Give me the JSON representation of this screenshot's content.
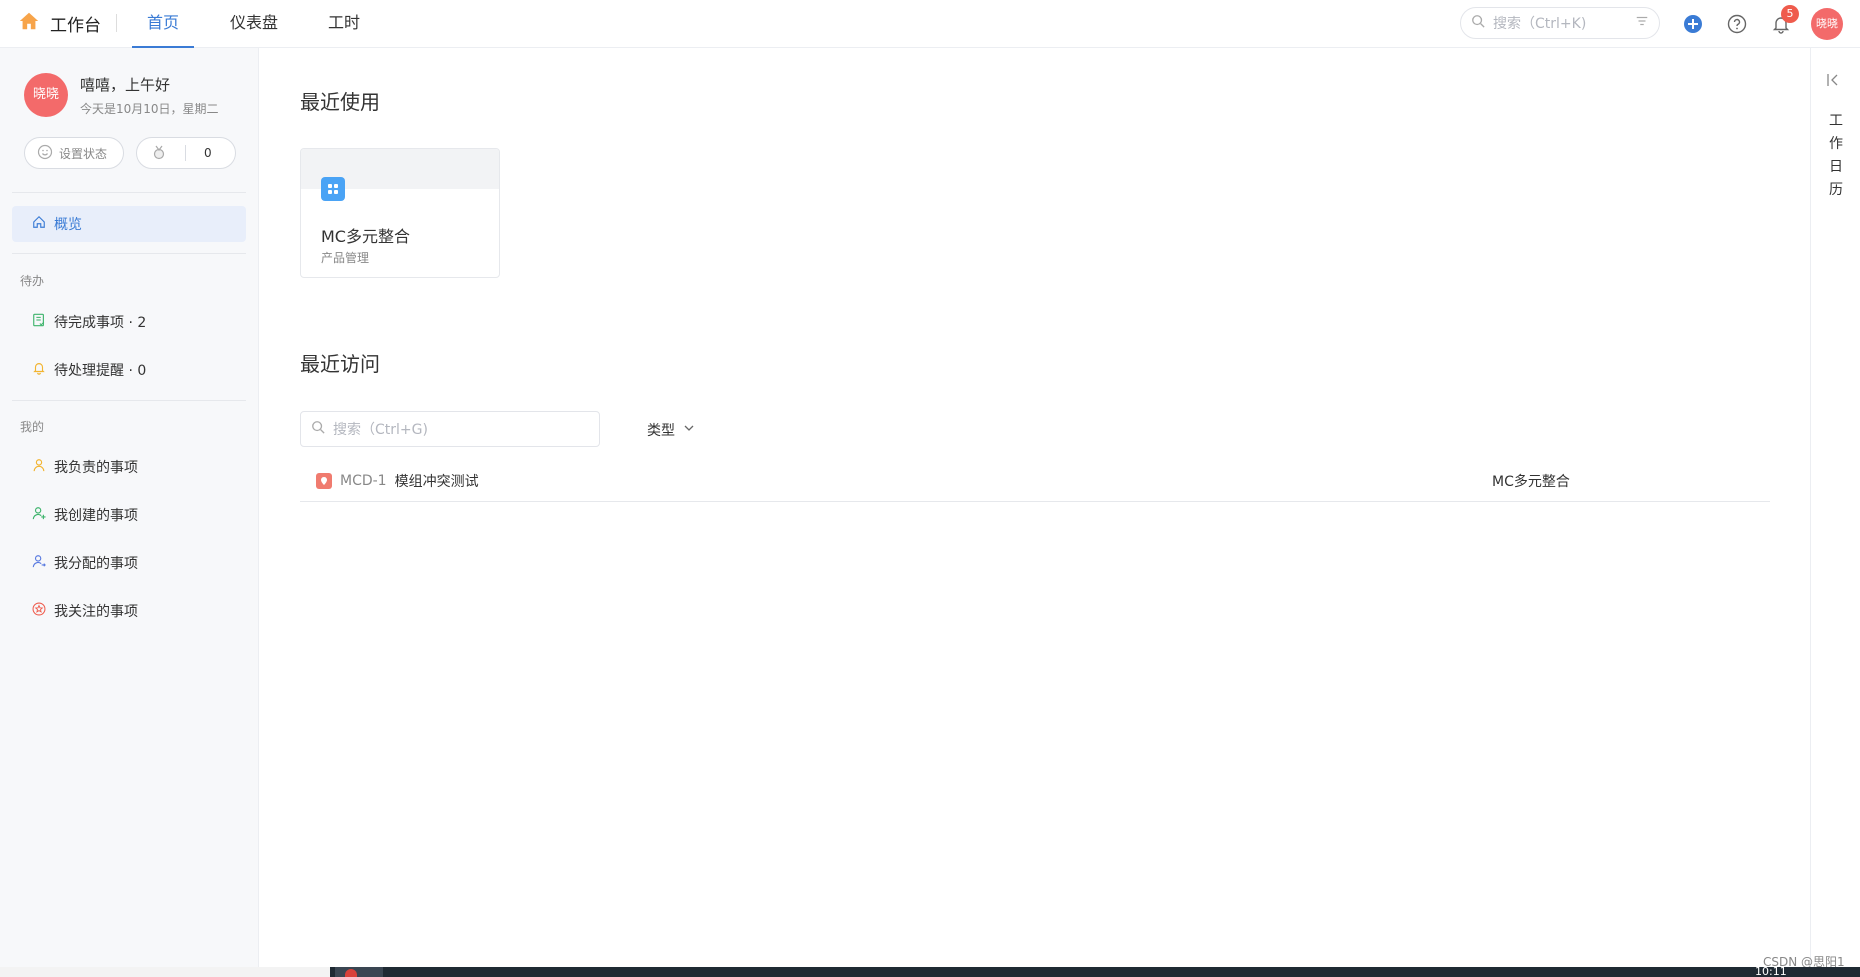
{
  "header": {
    "brand_title": "工作台",
    "tabs": [
      {
        "label": "首页",
        "active": true
      },
      {
        "label": "仪表盘",
        "active": false
      },
      {
        "label": "工时",
        "active": false
      }
    ],
    "search_placeholder": "搜索（Ctrl+K)",
    "notification_count": "5",
    "avatar_text": "晓晓",
    "accent_color": "#3a7bd5"
  },
  "sidebar": {
    "avatar_text": "晓晓",
    "greeting": "嘻嘻，上午好",
    "date": "今天是10月10日，星期二",
    "status_button": "设置状态",
    "medal_count": "0",
    "overview": "概览",
    "todo_section": "待办",
    "todo_items": [
      {
        "label": "待完成事项 · 2",
        "icon": "checklist-icon"
      },
      {
        "label": "待处理提醒 · 0",
        "icon": "bell-icon"
      }
    ],
    "mine_section": "我的",
    "mine_items": [
      {
        "label": "我负责的事项",
        "icon": "user-icon"
      },
      {
        "label": "我创建的事项",
        "icon": "user-add-icon"
      },
      {
        "label": "我分配的事项",
        "icon": "user-assign-icon"
      },
      {
        "label": "我关注的事项",
        "icon": "star-icon"
      }
    ]
  },
  "main": {
    "recent_used_title": "最近使用",
    "recent_card": {
      "title": "MC多元整合",
      "subtitle": "产品管理"
    },
    "recent_visit_title": "最近访问",
    "visit_search_placeholder": "搜索（Ctrl+G)",
    "type_filter": "类型",
    "rows": [
      {
        "key": "MCD-1",
        "title": "模组冲突测试",
        "project": "MC多元整合"
      }
    ]
  },
  "right_panel": {
    "label": "工作日历"
  },
  "taskbar": {
    "clock": "10:11"
  },
  "watermark": "CSDN @思阳1"
}
